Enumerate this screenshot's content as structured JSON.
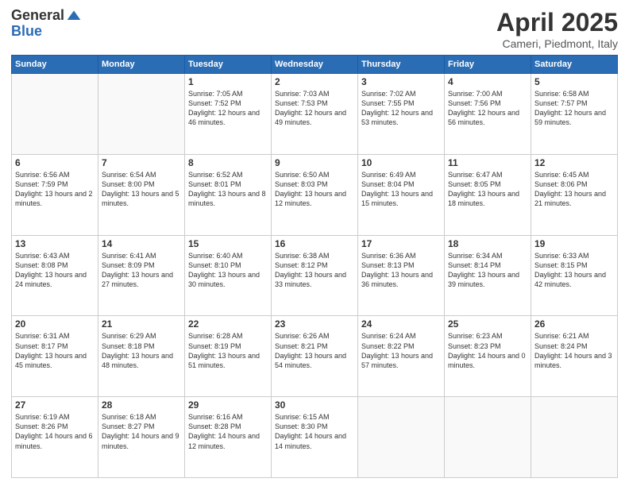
{
  "header": {
    "logo_general": "General",
    "logo_blue": "Blue",
    "title": "April 2025",
    "subtitle": "Cameri, Piedmont, Italy"
  },
  "weekdays": [
    "Sunday",
    "Monday",
    "Tuesday",
    "Wednesday",
    "Thursday",
    "Friday",
    "Saturday"
  ],
  "weeks": [
    [
      {
        "day": "",
        "info": ""
      },
      {
        "day": "",
        "info": ""
      },
      {
        "day": "1",
        "info": "Sunrise: 7:05 AM\nSunset: 7:52 PM\nDaylight: 12 hours and 46 minutes."
      },
      {
        "day": "2",
        "info": "Sunrise: 7:03 AM\nSunset: 7:53 PM\nDaylight: 12 hours and 49 minutes."
      },
      {
        "day": "3",
        "info": "Sunrise: 7:02 AM\nSunset: 7:55 PM\nDaylight: 12 hours and 53 minutes."
      },
      {
        "day": "4",
        "info": "Sunrise: 7:00 AM\nSunset: 7:56 PM\nDaylight: 12 hours and 56 minutes."
      },
      {
        "day": "5",
        "info": "Sunrise: 6:58 AM\nSunset: 7:57 PM\nDaylight: 12 hours and 59 minutes."
      }
    ],
    [
      {
        "day": "6",
        "info": "Sunrise: 6:56 AM\nSunset: 7:59 PM\nDaylight: 13 hours and 2 minutes."
      },
      {
        "day": "7",
        "info": "Sunrise: 6:54 AM\nSunset: 8:00 PM\nDaylight: 13 hours and 5 minutes."
      },
      {
        "day": "8",
        "info": "Sunrise: 6:52 AM\nSunset: 8:01 PM\nDaylight: 13 hours and 8 minutes."
      },
      {
        "day": "9",
        "info": "Sunrise: 6:50 AM\nSunset: 8:03 PM\nDaylight: 13 hours and 12 minutes."
      },
      {
        "day": "10",
        "info": "Sunrise: 6:49 AM\nSunset: 8:04 PM\nDaylight: 13 hours and 15 minutes."
      },
      {
        "day": "11",
        "info": "Sunrise: 6:47 AM\nSunset: 8:05 PM\nDaylight: 13 hours and 18 minutes."
      },
      {
        "day": "12",
        "info": "Sunrise: 6:45 AM\nSunset: 8:06 PM\nDaylight: 13 hours and 21 minutes."
      }
    ],
    [
      {
        "day": "13",
        "info": "Sunrise: 6:43 AM\nSunset: 8:08 PM\nDaylight: 13 hours and 24 minutes."
      },
      {
        "day": "14",
        "info": "Sunrise: 6:41 AM\nSunset: 8:09 PM\nDaylight: 13 hours and 27 minutes."
      },
      {
        "day": "15",
        "info": "Sunrise: 6:40 AM\nSunset: 8:10 PM\nDaylight: 13 hours and 30 minutes."
      },
      {
        "day": "16",
        "info": "Sunrise: 6:38 AM\nSunset: 8:12 PM\nDaylight: 13 hours and 33 minutes."
      },
      {
        "day": "17",
        "info": "Sunrise: 6:36 AM\nSunset: 8:13 PM\nDaylight: 13 hours and 36 minutes."
      },
      {
        "day": "18",
        "info": "Sunrise: 6:34 AM\nSunset: 8:14 PM\nDaylight: 13 hours and 39 minutes."
      },
      {
        "day": "19",
        "info": "Sunrise: 6:33 AM\nSunset: 8:15 PM\nDaylight: 13 hours and 42 minutes."
      }
    ],
    [
      {
        "day": "20",
        "info": "Sunrise: 6:31 AM\nSunset: 8:17 PM\nDaylight: 13 hours and 45 minutes."
      },
      {
        "day": "21",
        "info": "Sunrise: 6:29 AM\nSunset: 8:18 PM\nDaylight: 13 hours and 48 minutes."
      },
      {
        "day": "22",
        "info": "Sunrise: 6:28 AM\nSunset: 8:19 PM\nDaylight: 13 hours and 51 minutes."
      },
      {
        "day": "23",
        "info": "Sunrise: 6:26 AM\nSunset: 8:21 PM\nDaylight: 13 hours and 54 minutes."
      },
      {
        "day": "24",
        "info": "Sunrise: 6:24 AM\nSunset: 8:22 PM\nDaylight: 13 hours and 57 minutes."
      },
      {
        "day": "25",
        "info": "Sunrise: 6:23 AM\nSunset: 8:23 PM\nDaylight: 14 hours and 0 minutes."
      },
      {
        "day": "26",
        "info": "Sunrise: 6:21 AM\nSunset: 8:24 PM\nDaylight: 14 hours and 3 minutes."
      }
    ],
    [
      {
        "day": "27",
        "info": "Sunrise: 6:19 AM\nSunset: 8:26 PM\nDaylight: 14 hours and 6 minutes."
      },
      {
        "day": "28",
        "info": "Sunrise: 6:18 AM\nSunset: 8:27 PM\nDaylight: 14 hours and 9 minutes."
      },
      {
        "day": "29",
        "info": "Sunrise: 6:16 AM\nSunset: 8:28 PM\nDaylight: 14 hours and 12 minutes."
      },
      {
        "day": "30",
        "info": "Sunrise: 6:15 AM\nSunset: 8:30 PM\nDaylight: 14 hours and 14 minutes."
      },
      {
        "day": "",
        "info": ""
      },
      {
        "day": "",
        "info": ""
      },
      {
        "day": "",
        "info": ""
      }
    ]
  ]
}
